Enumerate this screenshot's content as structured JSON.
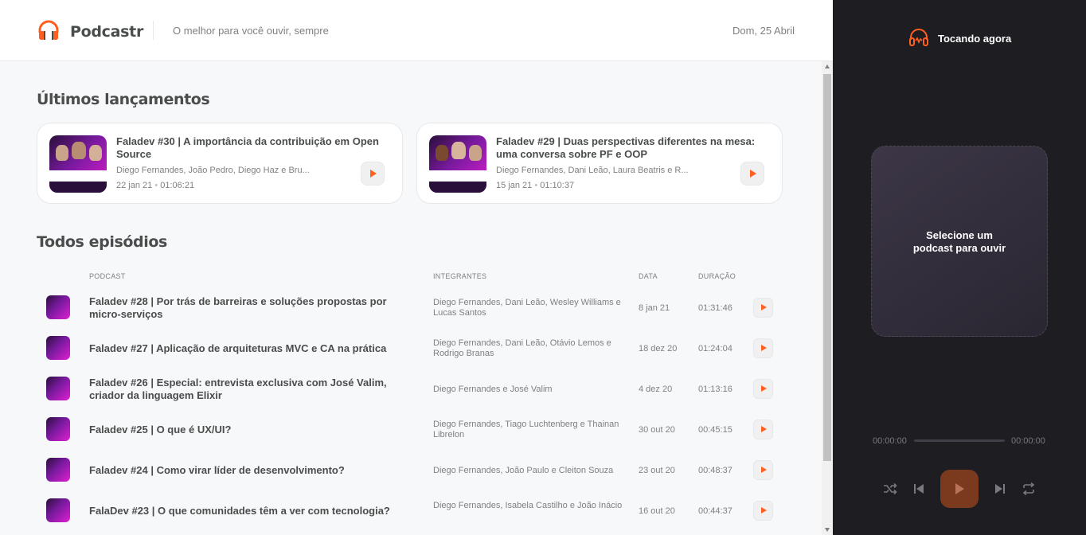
{
  "header": {
    "brand": "Podcastr",
    "tagline": "O melhor para você ouvir, sempre",
    "date": "Dom, 25 Abril"
  },
  "latest": {
    "title": "Últimos lançamentos",
    "episodes": [
      {
        "title": "Faladev #30 | A importância da contribuição em Open Source",
        "members": "Diego Fernandes, João Pedro, Diego Haz e Bru...",
        "date": "22 jan 21",
        "duration": "01:06:21",
        "thumb_caption": "Por que é tão importante contribuir em Open S..."
      },
      {
        "title": "Faladev #29 | Duas perspectivas diferentes na mesa: uma conversa sobre PF e OOP",
        "members": "Diego Fernandes, Dani Leão, Laura Beatris e R...",
        "date": "15 jan 21",
        "duration": "01:10:37",
        "thumb_caption": "Programação funcional vs devs orientados a o..."
      }
    ],
    "separator": "•"
  },
  "all": {
    "title": "Todos episódios",
    "columns": [
      "PODCAST",
      "INTEGRANTES",
      "DATA",
      "DURAÇÃO"
    ],
    "rows": [
      {
        "title": "Faladev #28 | Por trás de barreiras e soluções propostas por micro-serviços",
        "members": "Diego Fernandes, Dani Leão, Wesley Williams e Lucas Santos",
        "date": "8 jan 21",
        "duration": "01:31:46"
      },
      {
        "title": "Faladev #27 | Aplicação de arquiteturas MVC e CA na prática",
        "members": "Diego Fernandes, Dani Leão, Otávio Lemos e Rodrigo Branas",
        "date": "18 dez 20",
        "duration": "01:24:04"
      },
      {
        "title": "Faladev #26 | Especial: entrevista exclusiva com José Valim, criador da linguagem Elixir",
        "members": "Diego Fernandes e José Valim",
        "date": "4 dez 20",
        "duration": "01:13:16"
      },
      {
        "title": "Faladev #25 | O que é UX/UI?",
        "members": "Diego Fernandes, Tiago Luchtenberg e Thainan Librelon",
        "date": "30 out 20",
        "duration": "00:45:15"
      },
      {
        "title": "Faladev #24 | Como virar líder de desenvolvimento?",
        "members": "Diego Fernandes, João Paulo e Cleiton Souza",
        "date": "23 out 20",
        "duration": "00:48:37"
      },
      {
        "title": "FalaDev #23 | O que comunidades têm a ver com tecnologia?",
        "members": "Diego Fernandes, Isabela Castilho e João Inácio",
        "date": "16 out 20",
        "duration": "00:44:37"
      }
    ]
  },
  "player": {
    "title": "Tocando agora",
    "empty_text": "Selecione um podcast para ouvir",
    "current_time": "00:00:00",
    "total_time": "00:00:00",
    "controls": [
      "shuffle-icon",
      "previous-icon",
      "play-icon",
      "next-icon",
      "repeat-icon"
    ]
  },
  "colors": {
    "accent": "#ff5f1f",
    "player_bg": "#1e1d22",
    "text": "#494d4b",
    "muted": "#808080"
  }
}
